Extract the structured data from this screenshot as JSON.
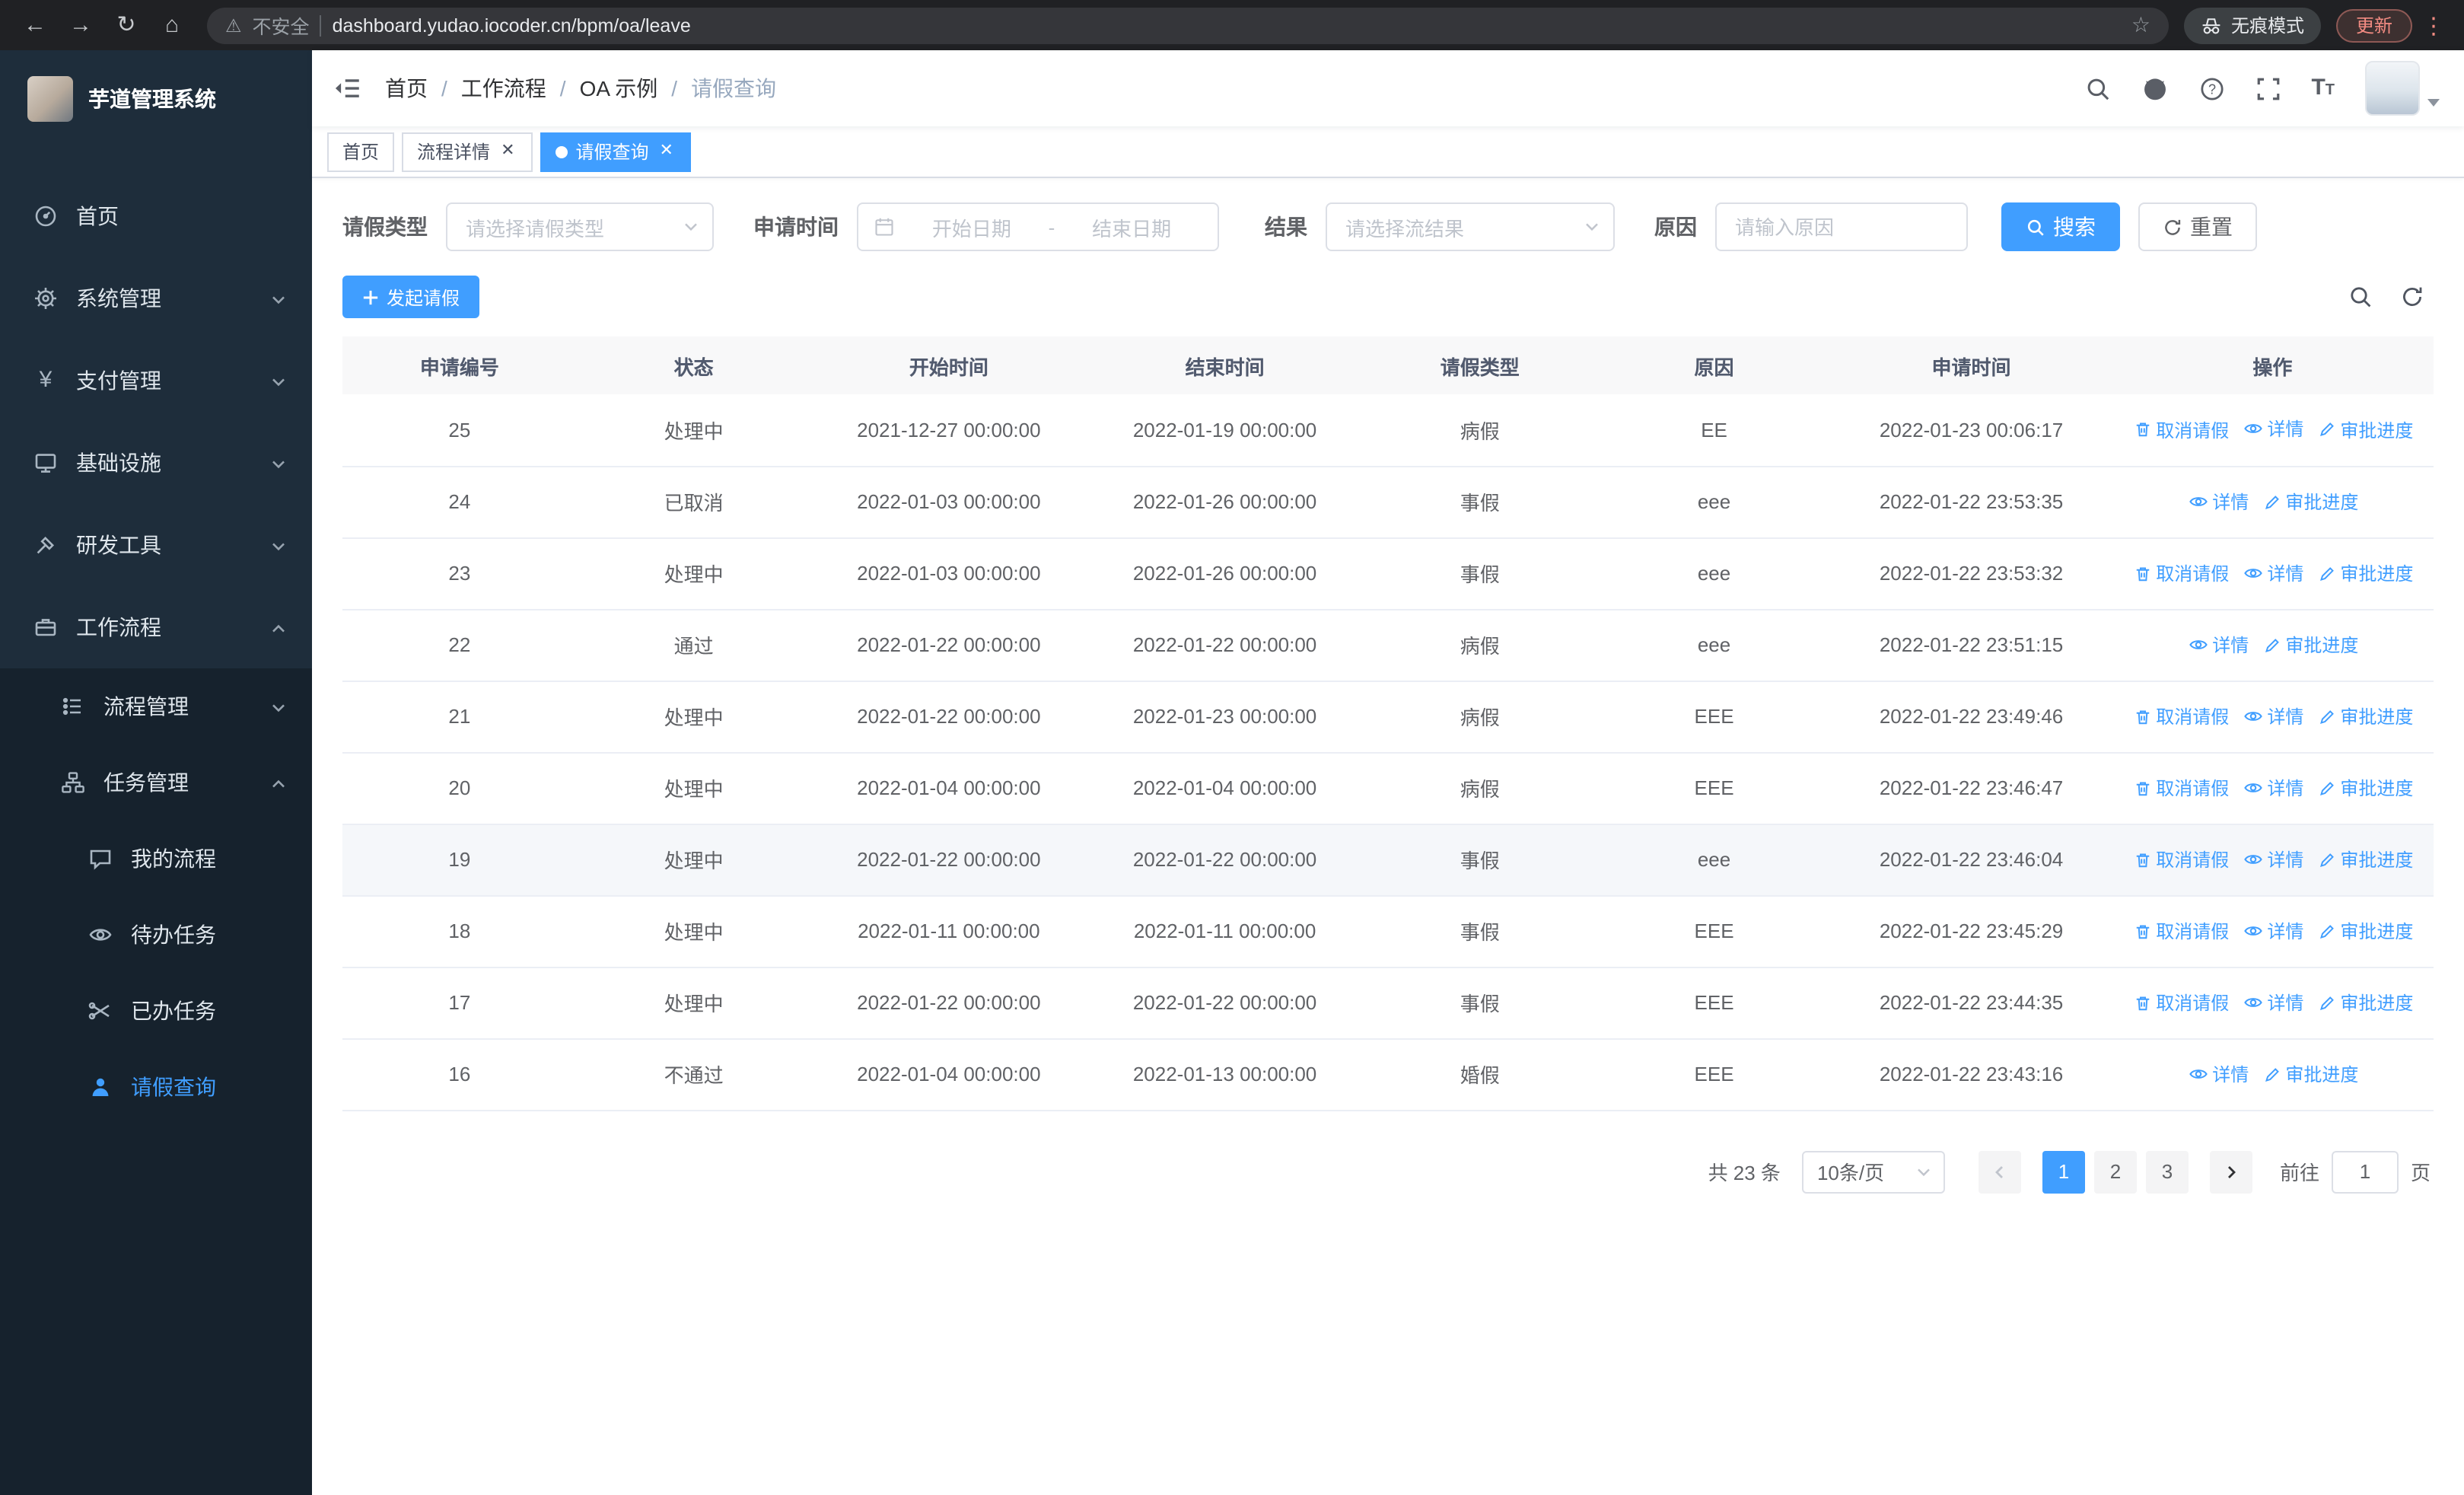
{
  "browser": {
    "security_label": "不安全",
    "url": "dashboard.yudao.iocoder.cn/bpm/oa/leave",
    "incognito_label": "无痕模式",
    "update_label": "更新"
  },
  "sidebar": {
    "logo_title": "芋道管理系统",
    "items": [
      {
        "label": "首页",
        "icon": "dashboard-icon"
      },
      {
        "label": "系统管理",
        "icon": "gear-icon"
      },
      {
        "label": "支付管理",
        "icon": "yen-icon"
      },
      {
        "label": "基础设施",
        "icon": "monitor-icon"
      },
      {
        "label": "研发工具",
        "icon": "tools-icon"
      },
      {
        "label": "工作流程",
        "icon": "briefcase-icon"
      }
    ],
    "submenu": [
      {
        "label": "流程管理",
        "icon": "list-icon"
      },
      {
        "label": "任务管理",
        "icon": "hierarchy-icon"
      }
    ],
    "subsubmenu": [
      {
        "label": "我的流程",
        "icon": "chat-icon"
      },
      {
        "label": "待办任务",
        "icon": "eye-icon"
      },
      {
        "label": "已办任务",
        "icon": "done-tasks-icon"
      },
      {
        "label": "请假查询",
        "icon": "user-icon"
      }
    ]
  },
  "header": {
    "breadcrumb": [
      "首页",
      "工作流程",
      "OA 示例",
      "请假查询"
    ]
  },
  "tabs": [
    {
      "label": "首页"
    },
    {
      "label": "流程详情"
    },
    {
      "label": "请假查询"
    }
  ],
  "filters": {
    "leave_type_label": "请假类型",
    "leave_type_placeholder": "请选择请假类型",
    "apply_time_label": "申请时间",
    "start_date_placeholder": "开始日期",
    "range_separator": "-",
    "end_date_placeholder": "结束日期",
    "result_label": "结果",
    "result_placeholder": "请选择流结果",
    "reason_label": "原因",
    "reason_placeholder": "请输入原因",
    "search_label": "搜索",
    "reset_label": "重置"
  },
  "toolbar": {
    "create_label": "发起请假"
  },
  "table": {
    "columns": [
      "申请编号",
      "状态",
      "开始时间",
      "结束时间",
      "请假类型",
      "原因",
      "申请时间",
      "操作"
    ],
    "actions": {
      "cancel": "取消请假",
      "detail": "详情",
      "progress": "审批进度"
    },
    "rows": [
      {
        "id": "25",
        "status": "处理中",
        "start": "2021-12-27 00:00:00",
        "end": "2022-01-19 00:00:00",
        "type": "病假",
        "reason": "EE",
        "applied": "2022-01-23 00:06:17",
        "cancellable": true,
        "highlighted": false
      },
      {
        "id": "24",
        "status": "已取消",
        "start": "2022-01-03 00:00:00",
        "end": "2022-01-26 00:00:00",
        "type": "事假",
        "reason": "eee",
        "applied": "2022-01-22 23:53:35",
        "cancellable": false,
        "highlighted": false
      },
      {
        "id": "23",
        "status": "处理中",
        "start": "2022-01-03 00:00:00",
        "end": "2022-01-26 00:00:00",
        "type": "事假",
        "reason": "eee",
        "applied": "2022-01-22 23:53:32",
        "cancellable": true,
        "highlighted": false
      },
      {
        "id": "22",
        "status": "通过",
        "start": "2022-01-22 00:00:00",
        "end": "2022-01-22 00:00:00",
        "type": "病假",
        "reason": "eee",
        "applied": "2022-01-22 23:51:15",
        "cancellable": false,
        "highlighted": false
      },
      {
        "id": "21",
        "status": "处理中",
        "start": "2022-01-22 00:00:00",
        "end": "2022-01-23 00:00:00",
        "type": "病假",
        "reason": "EEE",
        "applied": "2022-01-22 23:49:46",
        "cancellable": true,
        "highlighted": false
      },
      {
        "id": "20",
        "status": "处理中",
        "start": "2022-01-04 00:00:00",
        "end": "2022-01-04 00:00:00",
        "type": "病假",
        "reason": "EEE",
        "applied": "2022-01-22 23:46:47",
        "cancellable": true,
        "highlighted": false
      },
      {
        "id": "19",
        "status": "处理中",
        "start": "2022-01-22 00:00:00",
        "end": "2022-01-22 00:00:00",
        "type": "事假",
        "reason": "eee",
        "applied": "2022-01-22 23:46:04",
        "cancellable": true,
        "highlighted": true
      },
      {
        "id": "18",
        "status": "处理中",
        "start": "2022-01-11 00:00:00",
        "end": "2022-01-11 00:00:00",
        "type": "事假",
        "reason": "EEE",
        "applied": "2022-01-22 23:45:29",
        "cancellable": true,
        "highlighted": false
      },
      {
        "id": "17",
        "status": "处理中",
        "start": "2022-01-22 00:00:00",
        "end": "2022-01-22 00:00:00",
        "type": "事假",
        "reason": "EEE",
        "applied": "2022-01-22 23:44:35",
        "cancellable": true,
        "highlighted": false
      },
      {
        "id": "16",
        "status": "不通过",
        "start": "2022-01-04 00:00:00",
        "end": "2022-01-13 00:00:00",
        "type": "婚假",
        "reason": "EEE",
        "applied": "2022-01-22 23:43:16",
        "cancellable": false,
        "highlighted": false
      }
    ]
  },
  "pagination": {
    "total_label": "共 23 条",
    "page_size_label": "10条/页",
    "pages": [
      "1",
      "2",
      "3"
    ],
    "active_page": "1",
    "goto_label": "前往",
    "goto_value": "1",
    "goto_suffix": "页"
  },
  "colors": {
    "primary": "#409eff",
    "sidebar_bg": "#1e2d3b",
    "submenu_bg": "#16222d",
    "chrome_bg": "#202124",
    "update_chip": "#f28b82"
  }
}
